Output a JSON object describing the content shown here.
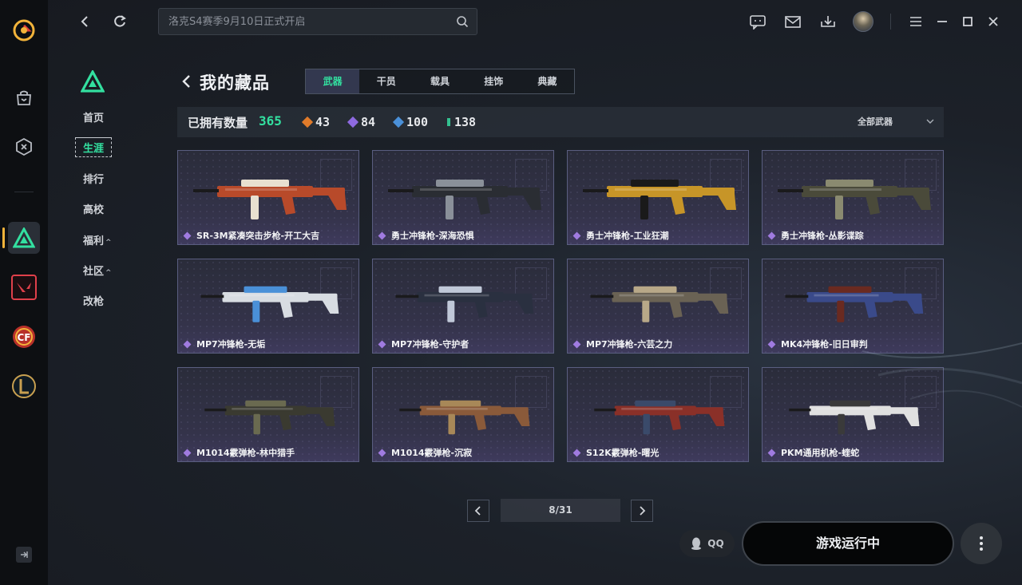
{
  "search": {
    "placeholder": "洛克S4赛季9月10日正式开启"
  },
  "subnav": {
    "items": [
      {
        "label": "首页"
      },
      {
        "label": "生涯",
        "active": true
      },
      {
        "label": "排行"
      },
      {
        "label": "高校"
      },
      {
        "label": "福利"
      },
      {
        "label": "社区"
      },
      {
        "label": "改枪"
      }
    ]
  },
  "page": {
    "title": "我的藏品"
  },
  "tabs": [
    "武器",
    "干员",
    "载具",
    "挂饰",
    "典藏"
  ],
  "stats": {
    "owned_label": "已拥有数量",
    "owned_count": "365",
    "rarities": [
      {
        "value": "43",
        "color": "#e07b2a"
      },
      {
        "value": "84",
        "color": "#8e6ae0"
      },
      {
        "value": "100",
        "color": "#4a90d8"
      },
      {
        "value": "138",
        "color": "#33c090"
      }
    ],
    "filter_label": "全部武器"
  },
  "weapons": [
    {
      "name": "SR-3M紧凑突击步枪-开工大吉",
      "body": "#b84a2a",
      "accent": "#e8e0d0"
    },
    {
      "name": "勇士冲锋枪-深海恐惧",
      "body": "#2a2d33",
      "accent": "#8a9099"
    },
    {
      "name": "勇士冲锋枪-工业狂潮",
      "body": "#c79528",
      "accent": "#1a1a1a"
    },
    {
      "name": "勇士冲锋枪-丛影谍踪",
      "body": "#4a4a3a",
      "accent": "#8a8a70"
    },
    {
      "name": "MP7冲锋枪-无垢",
      "body": "#d8dce2",
      "accent": "#4a90d8"
    },
    {
      "name": "MP7冲锋枪-守护者",
      "body": "#2a3040",
      "accent": "#c0c8d8"
    },
    {
      "name": "MP7冲锋枪-六芸之力",
      "body": "#6a6254",
      "accent": "#b8a888"
    },
    {
      "name": "MK4冲锋枪-旧日审判",
      "body": "#3a4a8a",
      "accent": "#6a2a20"
    },
    {
      "name": "M1014霰弹枪-林中猎手",
      "body": "#3a3a30",
      "accent": "#6a6a50"
    },
    {
      "name": "M1014霰弹枪-沉寂",
      "body": "#8a5a3a",
      "accent": "#a88858"
    },
    {
      "name": "S12K霰弹枪-曙光",
      "body": "#8a3028",
      "accent": "#3a4a6a"
    },
    {
      "name": "PKM通用机枪-蝰蛇",
      "body": "#e0e0e0",
      "accent": "#3a3a3a"
    }
  ],
  "pagination": {
    "text": "8/31"
  },
  "bottom": {
    "qq_label": "QQ",
    "play_label": "游戏运行中"
  },
  "icons": {
    "rail": [
      "app-logo-icon",
      "store-icon",
      "game-controller-icon",
      "delta-game-icon",
      "valorant-icon",
      "crossfire-icon",
      "league-icon",
      "collapse-icon"
    ],
    "topbar": [
      "back-icon",
      "refresh-icon",
      "search-icon",
      "chat-icon",
      "mail-icon",
      "download-icon",
      "menu-icon",
      "minimize-icon",
      "maximize-icon",
      "close-icon"
    ]
  }
}
